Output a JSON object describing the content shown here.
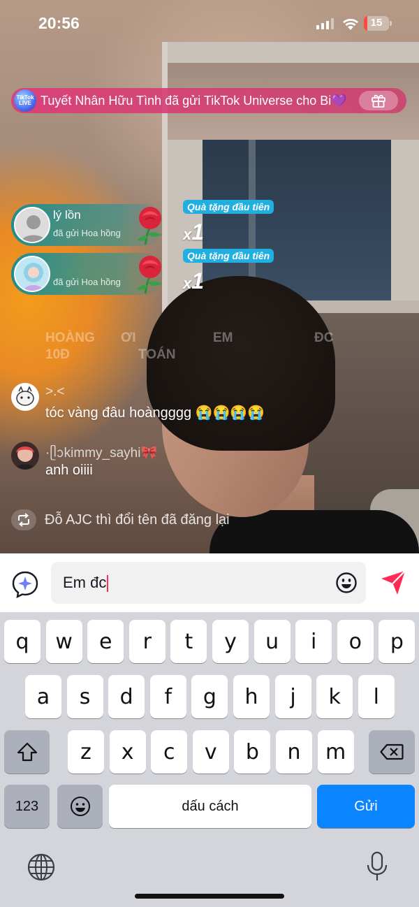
{
  "status_bar": {
    "time": "20:56",
    "battery": "15",
    "battery_level": 0.15
  },
  "gift_banner": {
    "badge": "TikTok LIVE",
    "text": "Tuyết Nhân Hữu Tình đã gửi TikTok Universe cho Bi💜"
  },
  "gifts": [
    {
      "user": "lý lồn",
      "action": "đã gửi Hoa hồng",
      "tag": "Quà tặng đầu tiên",
      "combo_prefix": "x",
      "combo": "1"
    },
    {
      "user": "",
      "action": "đã gửi Hoa hồng",
      "tag": "Quà tặng đầu tiên",
      "combo_prefix": "x",
      "combo": "1"
    }
  ],
  "faded_row": {
    "col1": "HOÀNG",
    "col1_sub": "10Đ",
    "col2": "ƠI",
    "col2_sub": "TOÁN",
    "col3": "EM",
    "col4": "ĐC"
  },
  "comments": [
    {
      "user": ">.<",
      "text": "tóc vàng đâu hoàngggg 😭😭😭😭"
    },
    {
      "user": "·ᥫᩣkimmy_sayhi🎀",
      "text": "anh oiiii"
    }
  ],
  "repost": {
    "text": "Đỗ AJC thì đổi tên đã đăng lại"
  },
  "input": {
    "value": "Em đc"
  },
  "keyboard": {
    "row1": [
      "q",
      "w",
      "e",
      "r",
      "t",
      "y",
      "u",
      "i",
      "o",
      "p"
    ],
    "row2": [
      "a",
      "s",
      "d",
      "f",
      "g",
      "h",
      "j",
      "k",
      "l"
    ],
    "row3": [
      "z",
      "x",
      "c",
      "v",
      "b",
      "n",
      "m"
    ],
    "numbers_label": "123",
    "space_label": "dấu cách",
    "send_label": "Gửi"
  },
  "colors": {
    "accent": "#fe2c55",
    "send_key": "#0a84ff",
    "gift_teal": "#1c9aa3",
    "banner_pink": "#dc3c78"
  },
  "icons": [
    "signal-icon",
    "wifi-icon",
    "battery-icon",
    "gift-icon",
    "rose-icon",
    "repost-icon",
    "ai-sparkle-icon",
    "emoji-icon",
    "send-icon",
    "shift-icon",
    "backspace-icon",
    "globe-icon",
    "mic-icon"
  ]
}
